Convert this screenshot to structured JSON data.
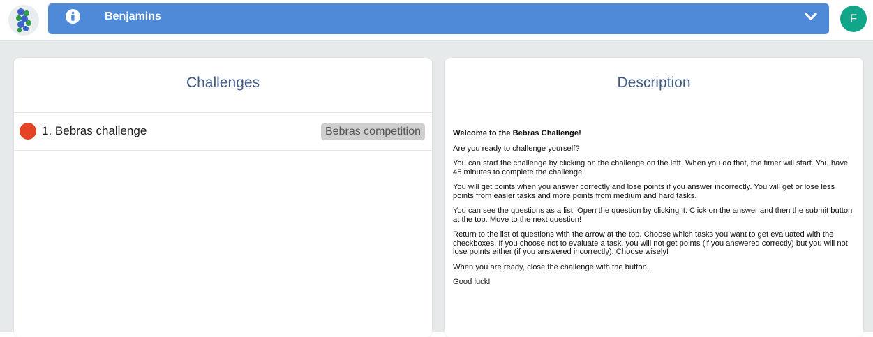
{
  "header": {
    "class_name": "Benjamins",
    "user_initial": "F",
    "colors": {
      "bar": "#4f8ad9",
      "avatar": "#11a68a"
    }
  },
  "challenges": {
    "title": "Challenges",
    "items": [
      {
        "label": "1. Bebras challenge",
        "tag": "Bebras competition",
        "status_color": "#e34524"
      }
    ]
  },
  "description": {
    "title": "Description",
    "heading": "Welcome to the Bebras Challenge!",
    "paragraphs": [
      "Are you ready to challenge yourself?",
      "You can start the challenge by clicking on the challenge on the left. When you do that, the timer will start. You have 45 minutes to complete the challenge.",
      "You will get points when you answer correctly and lose points if you answer incorrectly. You will get or lose less points from easier tasks and more points from medium and hard tasks.",
      "You can see the questions as a list. Open the question by clicking it. Click on the answer and then the submit button at the top. Move to the next question!",
      "Return to the list of questions with the arrow at the top. Choose which tasks you want to get evaluated with the checkboxes. If you choose not to evaluate a task, you will not get points (if you answered correctly) but you will not lose points either (if you answered incorrectly). Choose wisely!",
      "When you are ready, close the challenge with the button.",
      "Good luck!"
    ]
  }
}
